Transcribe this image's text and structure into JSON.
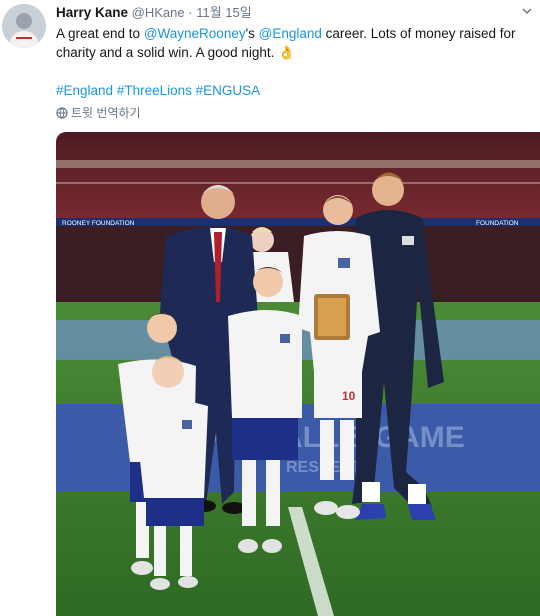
{
  "tweet": {
    "author_name": "Harry Kane",
    "handle": "@HKane",
    "separator": "·",
    "timestamp": "11월 15일",
    "text_1": "A great end to ",
    "mention_1": "@WayneRooney",
    "text_2": "'s ",
    "mention_2": "@England",
    "text_3": " career. Lots of money raised for charity and a solid win. A good night. ",
    "emoji": "👌",
    "hashtags": [
      "#England",
      "#ThreeLions",
      "#ENGUSA"
    ],
    "translate_label": "트윗 번역하기"
  },
  "photo": {
    "banner_left": "ROONEY FOUNDATION",
    "banner_right": "FOUNDATION",
    "boards_text": "FOOTBALL'S GAME",
    "boards_subtext": "RESPECT",
    "shirt_number": "10"
  },
  "colors": {
    "link": "#1b95e0",
    "muted": "#657786",
    "pitch": "#3f7f2e",
    "board_blue": "#3b5aa8",
    "navy": "#1c2541"
  },
  "icons": {
    "caret": "chevron-down-icon",
    "translate": "globe-icon"
  }
}
